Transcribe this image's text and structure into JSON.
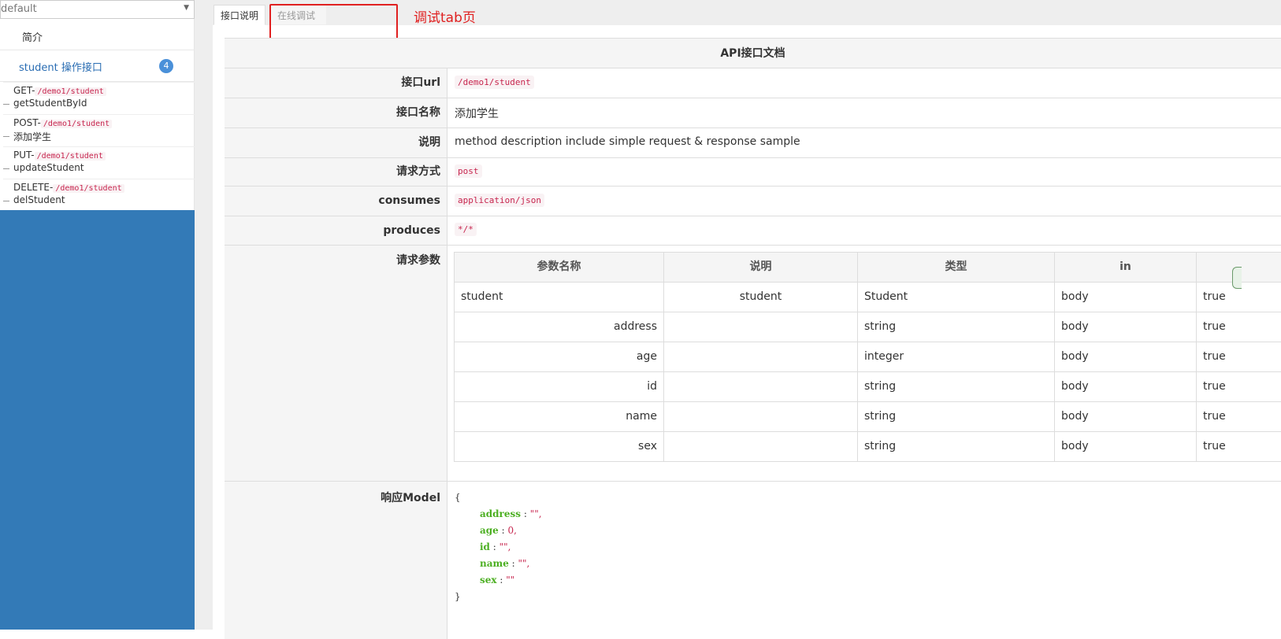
{
  "sidebar": {
    "group_select": "default",
    "intro": "简介",
    "tag": {
      "label": "student 操作接口",
      "count": "4"
    },
    "apis": [
      {
        "method": "GET-",
        "path": "/demo1/student",
        "name": "getStudentById"
      },
      {
        "method": "POST-",
        "path": "/demo1/student",
        "name": "添加学生"
      },
      {
        "method": "PUT-",
        "path": "/demo1/student",
        "name": "updateStudent"
      },
      {
        "method": "DELETE-",
        "path": "/demo1/student",
        "name": "delStudent"
      }
    ]
  },
  "tabs": {
    "doc": "接口说明",
    "debug": "在线调试"
  },
  "annotation": "调试tab页",
  "doc": {
    "title": "API接口文档",
    "url_label": "接口url",
    "url": "/demo1/student",
    "name_label": "接口名称",
    "name": "添加学生",
    "desc_label": "说明",
    "desc": "method description include simple request & response sample",
    "method_label": "请求方式",
    "method": "post",
    "consumes_label": "consumes",
    "consumes": "application/json",
    "produces_label": "produces",
    "produces": "*/*",
    "params_label": "请求参数",
    "params_headers": [
      "参数名称",
      "说明",
      "类型",
      "in",
      ""
    ],
    "params": [
      {
        "name": "student",
        "desc": "student",
        "type": "Student",
        "in": "body",
        "required": "true"
      },
      {
        "name": "address",
        "desc": "",
        "type": "string",
        "in": "body",
        "required": "true"
      },
      {
        "name": "age",
        "desc": "",
        "type": "integer",
        "in": "body",
        "required": "true"
      },
      {
        "name": "id",
        "desc": "",
        "type": "string",
        "in": "body",
        "required": "true"
      },
      {
        "name": "name",
        "desc": "",
        "type": "string",
        "in": "body",
        "required": "true"
      },
      {
        "name": "sex",
        "desc": "",
        "type": "string",
        "in": "body",
        "required": "true"
      }
    ],
    "response_label": "响应Model",
    "response_model": {
      "open": "{",
      "fields": [
        {
          "key": "address",
          "sep": " : ",
          "value": "\"\","
        },
        {
          "key": "age",
          "sep": " : ",
          "value": "0,"
        },
        {
          "key": "id",
          "sep": " : ",
          "value": "\"\","
        },
        {
          "key": "name",
          "sep": " : ",
          "value": "\"\","
        },
        {
          "key": "sex",
          "sep": " : ",
          "value": "\"\""
        }
      ],
      "close": "}"
    }
  }
}
